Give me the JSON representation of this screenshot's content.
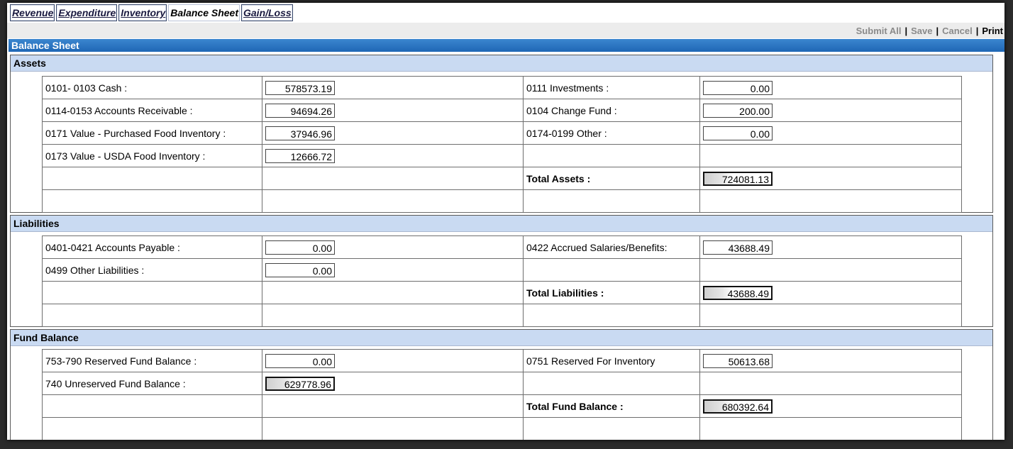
{
  "tabs": [
    {
      "label": "Revenue",
      "active": false
    },
    {
      "label": "Expenditure",
      "active": false
    },
    {
      "label": "Inventory",
      "active": false
    },
    {
      "label": "Balance Sheet",
      "active": true
    },
    {
      "label": "Gain/Loss",
      "active": false
    }
  ],
  "actions": {
    "submit_all": "Submit All",
    "save": "Save",
    "cancel": "Cancel",
    "print": "Print",
    "separator": "|"
  },
  "header": {
    "title": "Balance Sheet"
  },
  "assets": {
    "title": "Assets",
    "cash_label": "0101- 0103 Cash :",
    "cash_value": "578573.19",
    "investments_label": "0111 Investments :",
    "investments_value": "0.00",
    "ar_label": "0114-0153 Accounts Receivable :",
    "ar_value": "94694.26",
    "change_fund_label": "0104 Change Fund :",
    "change_fund_value": "200.00",
    "purchased_food_label": "0171 Value - Purchased Food Inventory :",
    "purchased_food_value": "37946.96",
    "other_label": "0174-0199 Other :",
    "other_value": "0.00",
    "usda_food_label": "0173 Value - USDA Food Inventory :",
    "usda_food_value": "12666.72",
    "total_label": "Total Assets :",
    "total_value": "724081.13"
  },
  "liabilities": {
    "title": "Liabilities",
    "ap_label": "0401-0421 Accounts Payable :",
    "ap_value": "0.00",
    "accrued_label": "0422 Accrued Salaries/Benefits:",
    "accrued_value": "43688.49",
    "other_label": "0499 Other Liabilities :",
    "other_value": "0.00",
    "total_label": "Total Liabilities :",
    "total_value": "43688.49"
  },
  "fund_balance": {
    "title": "Fund Balance",
    "reserved_label": "753-790 Reserved Fund Balance :",
    "reserved_value": "0.00",
    "inventory_label": "0751 Reserved For Inventory",
    "inventory_value": "50613.68",
    "unreserved_label": "740 Unreserved Fund Balance :",
    "unreserved_value": "629778.96",
    "total_label": "Total Fund Balance :",
    "total_value": "680392.64"
  }
}
